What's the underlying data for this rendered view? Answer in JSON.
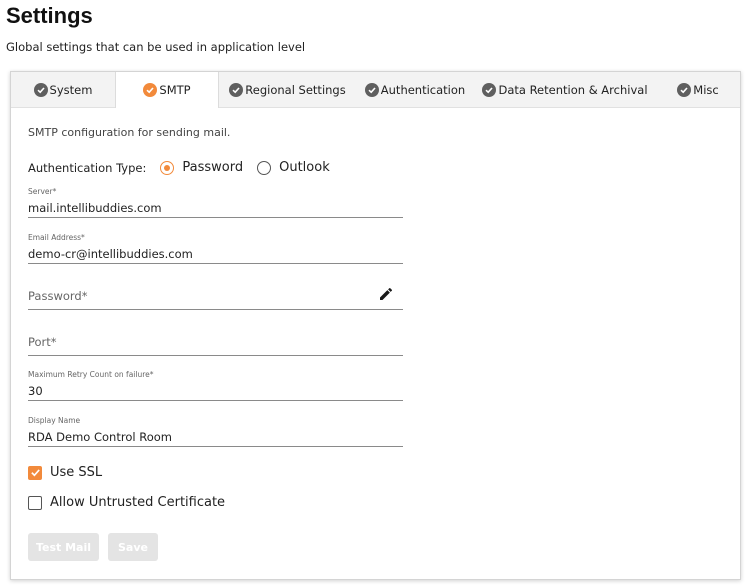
{
  "page": {
    "title": "Settings",
    "subtitle": "Global settings that can be used in application level"
  },
  "tabs": [
    {
      "label": "System",
      "icon": "check-circle-icon",
      "active": false
    },
    {
      "label": "SMTP",
      "icon": "check-circle-icon",
      "active": true
    },
    {
      "label": "Regional Settings",
      "icon": "check-circle-icon",
      "active": false
    },
    {
      "label": "Authentication",
      "icon": "check-circle-icon",
      "active": false
    },
    {
      "label": "Data Retention & Archival",
      "icon": "check-circle-icon",
      "active": false
    },
    {
      "label": "Misc",
      "icon": "check-circle-icon",
      "active": false
    }
  ],
  "smtp": {
    "description": "SMTP configuration for sending mail.",
    "auth_type": {
      "label": "Authentication Type:",
      "options": [
        "Password",
        "Outlook"
      ],
      "selected": "Password"
    },
    "server": {
      "label": "Server*",
      "value": "mail.intellibuddies.com"
    },
    "email": {
      "label": "Email Address*",
      "value": "demo-cr@intellibuddies.com"
    },
    "password": {
      "label": "Password*",
      "value": "",
      "icon": "pencil-icon"
    },
    "port": {
      "label": "Port*",
      "value": ""
    },
    "retry": {
      "label": "Maximum Retry Count on failure*",
      "value": "30"
    },
    "display_name": {
      "label": "Display Name",
      "value": "RDA Demo Control Room"
    },
    "use_ssl": {
      "label": "Use SSL",
      "checked": true
    },
    "allow_untrusted": {
      "label": "Allow Untrusted Certificate",
      "checked": false
    },
    "buttons": {
      "test_mail": "Test Mail",
      "save": "Save",
      "enabled": false
    }
  },
  "colors": {
    "accent": "#f28a3b",
    "tab_icon": "#5f5f5f",
    "button_disabled": "#e4e4e4"
  }
}
